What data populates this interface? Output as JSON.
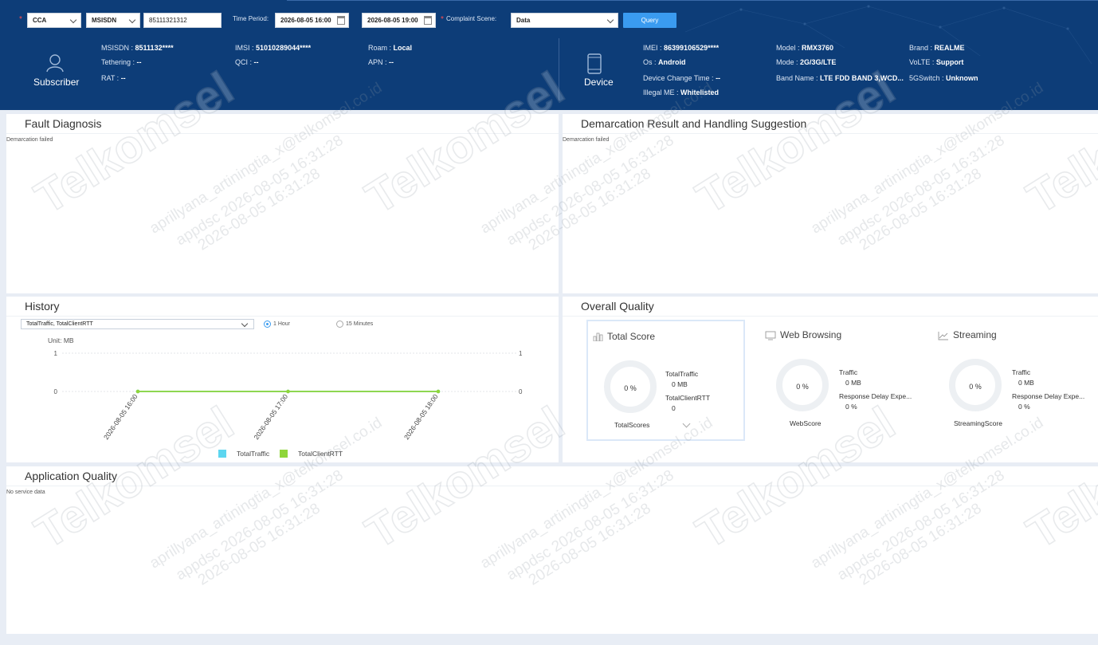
{
  "query": {
    "cca_select": "CCA",
    "id_type_select": "MSISDN",
    "msisdn_value": "85111321312",
    "time_period_label": "Time Period:",
    "start_time": "2026-08-05 16:00",
    "end_time": "2026-08-05 19:00",
    "complaint_scene_label": "Complaint Scene:",
    "complaint_scene_value": "Data",
    "query_button": "Query"
  },
  "subscriber": {
    "title": "Subscriber",
    "fields": [
      {
        "label": "MSISDN",
        "value": "8511132****"
      },
      {
        "label": "Tethering",
        "value": "--"
      },
      {
        "label": "RAT",
        "value": "--"
      },
      {
        "label": "IMSI",
        "value": "51010289044****"
      },
      {
        "label": "QCI",
        "value": "--"
      },
      {
        "label": "Roam",
        "value": "Local"
      },
      {
        "label": "APN",
        "value": "--"
      }
    ]
  },
  "device": {
    "title": "Device",
    "fields": [
      {
        "label": "IMEI",
        "value": "86399106529****"
      },
      {
        "label": "Os",
        "value": "Android"
      },
      {
        "label": "Device Change Time",
        "value": "--"
      },
      {
        "label": "Illegal ME",
        "value": "Whitelisted"
      },
      {
        "label": "Model",
        "value": "RMX3760"
      },
      {
        "label": "Mode",
        "value": "2G/3G/LTE"
      },
      {
        "label": "Band Name",
        "value": "LTE FDD BAND 3,WCD..."
      },
      {
        "label": "Brand",
        "value": "REALME"
      },
      {
        "label": "VoLTE",
        "value": "Support"
      },
      {
        "label": "5GSwitch",
        "value": "Unknown"
      }
    ]
  },
  "fault_diagnosis": {
    "title": "Fault Diagnosis",
    "note": "Demarcation failed"
  },
  "demarcation": {
    "title": "Demarcation Result and Handling Suggestion",
    "note": "Demarcation failed"
  },
  "history": {
    "title": "History",
    "metric_select": "TotalTraffic, TotalClientRTT",
    "radio_1h": "1 Hour",
    "radio_15m": "15 Minutes",
    "unit": "Unit: MB"
  },
  "chart_data": {
    "type": "line",
    "x": [
      "2026-08-05 16:00",
      "2026-08-05 17:00",
      "2026-08-05 18:00"
    ],
    "series": [
      {
        "name": "TotalTraffic",
        "values": [
          0,
          0,
          0
        ],
        "color": "#5dd6f0"
      },
      {
        "name": "TotalClientRTT",
        "values": [
          0,
          0,
          0
        ],
        "color": "#8fd63a"
      }
    ],
    "ylim": [
      0,
      1
    ],
    "yticks_left": [
      "1",
      "0"
    ],
    "yticks_right": [
      "1",
      "0"
    ],
    "ylabel": "Unit: MB",
    "legend": "bottom-center",
    "grid": true
  },
  "overall": {
    "title": "Overall Quality",
    "total": {
      "title": "Total Score",
      "score": "0 %",
      "m1": "TotalTraffic",
      "m1v": "0 MB",
      "m2": "TotalClientRTT",
      "m2v": "0",
      "name": "TotalScores"
    },
    "web": {
      "title": "Web Browsing",
      "score": "0 %",
      "m1": "Traffic",
      "m1v": "0 MB",
      "m2": "Response Delay Expe...",
      "m2v": "0 %",
      "name": "WebScore"
    },
    "stream": {
      "title": "Streaming",
      "score": "0 %",
      "m1": "Traffic",
      "m1v": "0 MB",
      "m2": "Response Delay Expe...",
      "m2v": "0 %",
      "name": "StreamingScore"
    }
  },
  "app_quality": {
    "title": "Application Quality",
    "note": "No service data"
  },
  "watermark": {
    "brand": "Telkomsel",
    "line1": "appdsc 2026-08-05 16:31:28",
    "line2": "aprillyana_artiningtia_x@telkomsel.co.id",
    "line3": "2026-08-05 16:31:28"
  }
}
